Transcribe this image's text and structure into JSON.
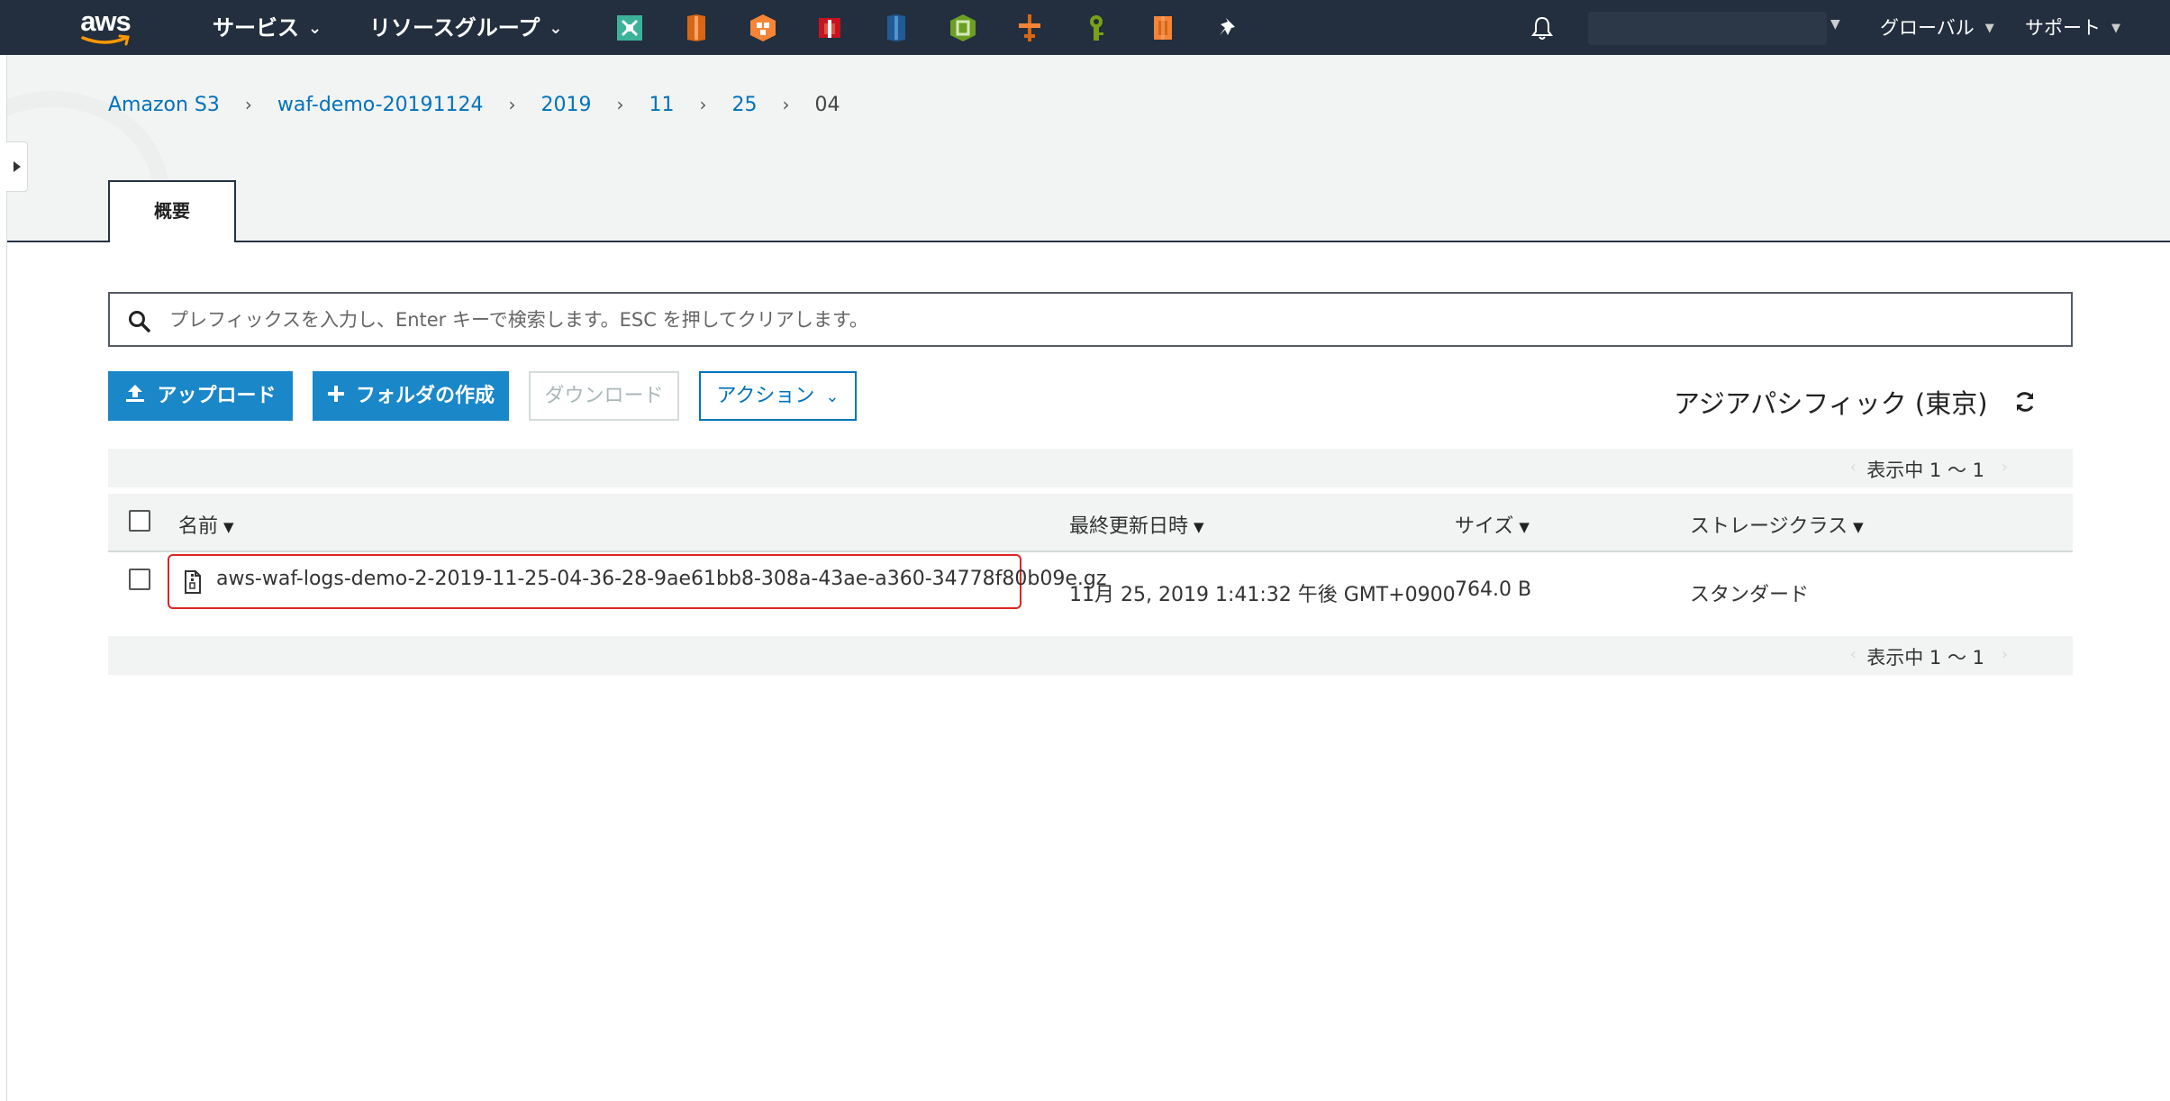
{
  "topnav": {
    "logo": "aws",
    "services_label": "サービス",
    "resource_groups_label": "リソースグループ",
    "pinned_icons": [
      "x-ray-icon",
      "lightsail-icon",
      "ecs-icon",
      "cloudhsm-icon",
      "s3-icon",
      "elastic-beanstalk-icon",
      "waf-icon",
      "secrets-manager-icon",
      "ec2-icon",
      "pin-icon"
    ],
    "global_label": "グローバル",
    "support_label": "サポート"
  },
  "breadcrumb": [
    "Amazon S3",
    "waf-demo-20191124",
    "2019",
    "11",
    "25",
    "04"
  ],
  "tabs": [
    {
      "label": "概要"
    }
  ],
  "search": {
    "placeholder": "プレフィックスを入力し、Enter キーで検索します。ESC を押してクリアします。"
  },
  "toolbar": {
    "upload_label": "アップロード",
    "create_folder_label": "フォルダの作成",
    "download_label": "ダウンロード",
    "actions_label": "アクション",
    "region_label": "アジアパシフィック (東京)"
  },
  "table": {
    "pager_top": "表示中 1 ～ 1",
    "pager_bottom": "表示中 1 ～ 1",
    "columns": [
      "名前",
      "最終更新日時",
      "サイズ",
      "ストレージクラス"
    ],
    "rows": [
      {
        "name": "aws-waf-logs-demo-2-2019-11-25-04-36-28-9ae61bb8-308a-43ae-a360-34778f80b09e.gz",
        "last_modified": "11月 25, 2019 1:41:32 午後 GMT+0900",
        "size": "764.0 B",
        "storage_class": "スタンダード"
      }
    ]
  },
  "colors": {
    "nav_bg": "#232f3e",
    "link": "#0073bb",
    "primary_button": "#1a87c9",
    "highlight": "#e02424"
  }
}
